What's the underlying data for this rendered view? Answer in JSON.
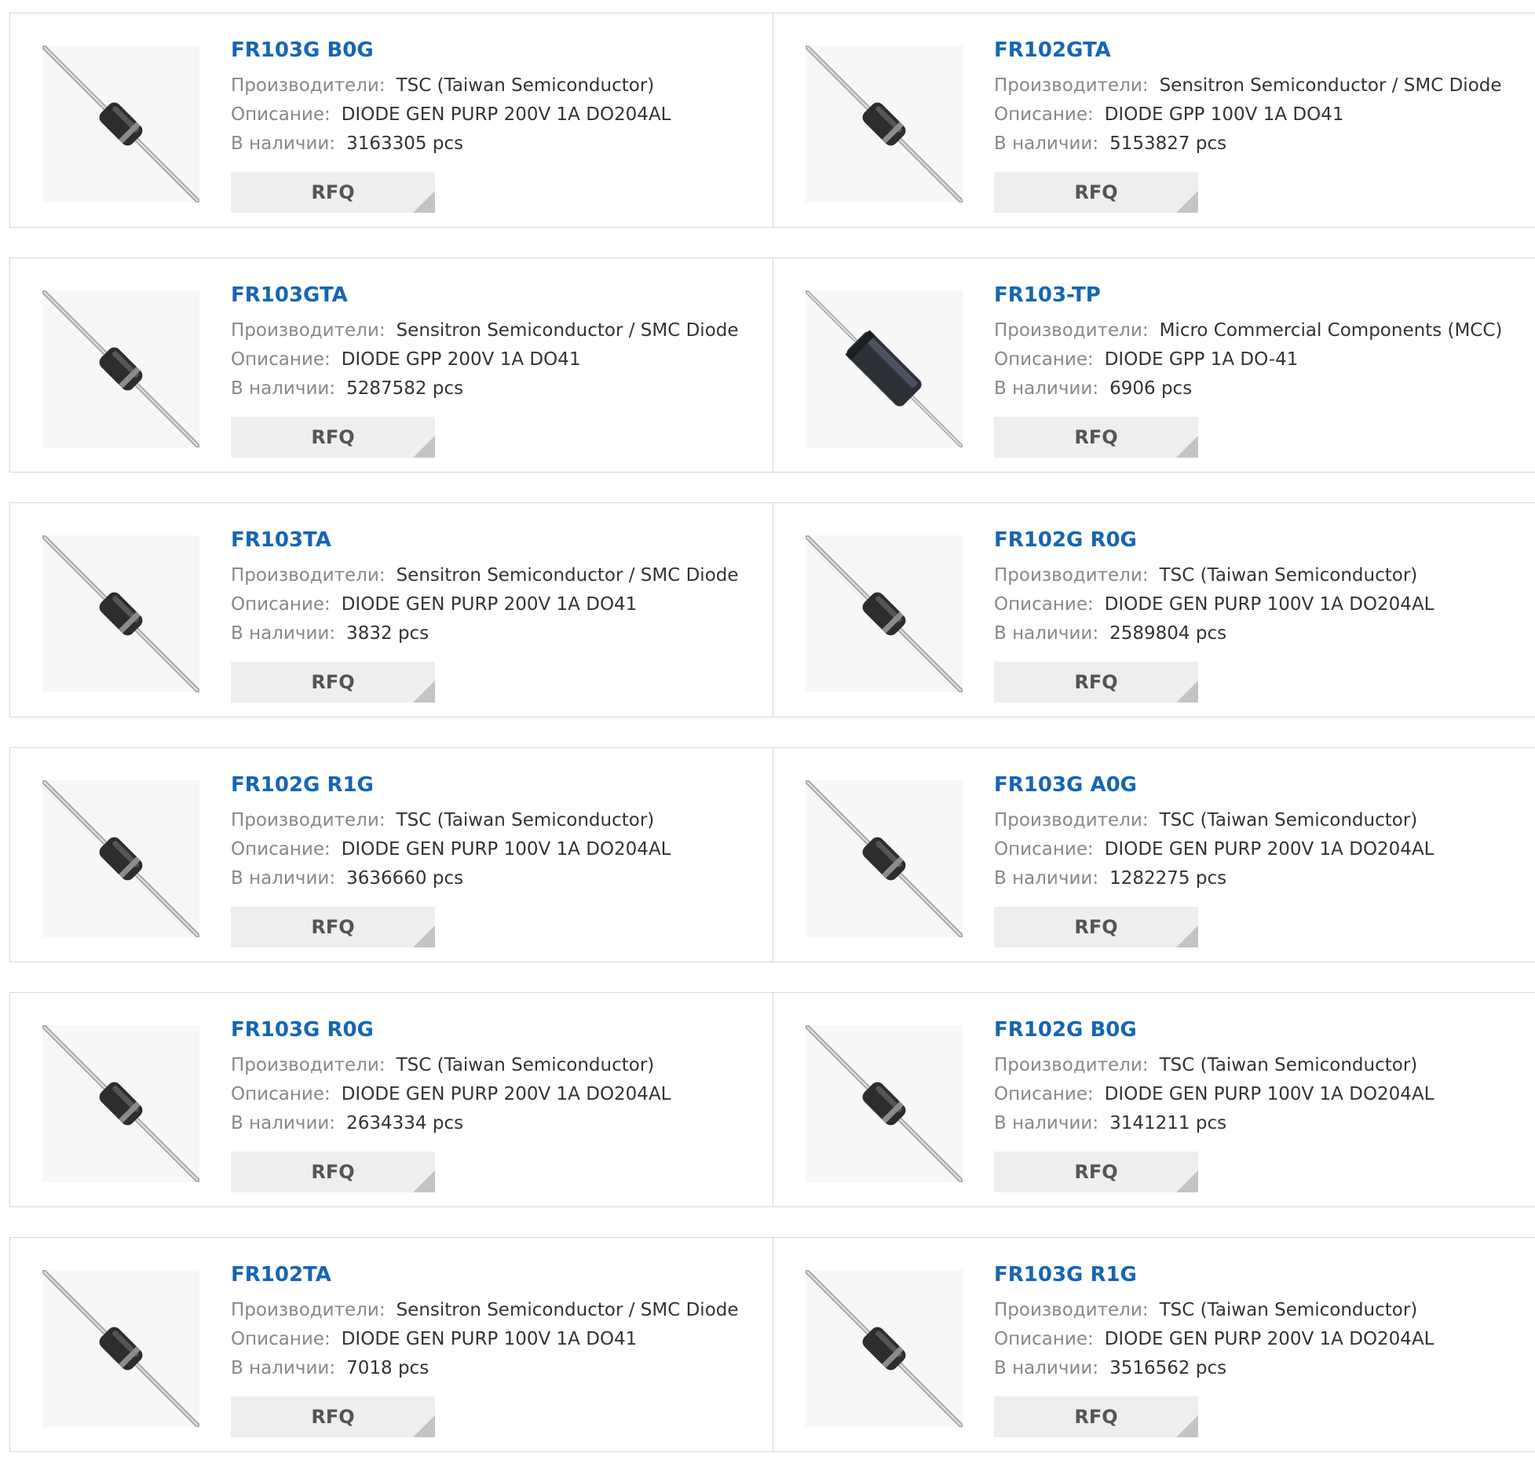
{
  "labels": {
    "manufacturer": "Производители:",
    "description": "Описание:",
    "stock": "В наличии:",
    "rfq": "RFQ"
  },
  "colors": {
    "title": "#1565b5",
    "label": "#888888",
    "border": "#d8d8d8",
    "button": "#eeeeee"
  },
  "products": [
    {
      "part": "FR103G B0G",
      "manufacturer": "TSC (Taiwan Semiconductor)",
      "description": "DIODE GEN PURP 200V 1A DO204AL",
      "stock": "3163305 pcs",
      "image": "diode-axial-icon"
    },
    {
      "part": "FR102GTA",
      "manufacturer": "Sensitron Semiconductor / SMC Diode",
      "description": "DIODE GPP 100V 1A DO41",
      "stock": "5153827 pcs",
      "image": "diode-axial-icon"
    },
    {
      "part": "FR103GTA",
      "manufacturer": "Sensitron Semiconductor / SMC Diode",
      "description": "DIODE GPP 200V 1A DO41",
      "stock": "5287582 pcs",
      "image": "diode-axial-icon"
    },
    {
      "part": "FR103-TP",
      "manufacturer": "Micro Commercial Components (MCC)",
      "description": "DIODE GPP 1A DO-41",
      "stock": "6906 pcs",
      "image": "diode-large-icon"
    },
    {
      "part": "FR103TA",
      "manufacturer": "Sensitron Semiconductor / SMC Diode",
      "description": "DIODE GEN PURP 200V 1A DO41",
      "stock": "3832 pcs",
      "image": "diode-axial-icon"
    },
    {
      "part": "FR102G R0G",
      "manufacturer": "TSC (Taiwan Semiconductor)",
      "description": "DIODE GEN PURP 100V 1A DO204AL",
      "stock": "2589804 pcs",
      "image": "diode-axial-icon"
    },
    {
      "part": "FR102G R1G",
      "manufacturer": "TSC (Taiwan Semiconductor)",
      "description": "DIODE GEN PURP 100V 1A DO204AL",
      "stock": "3636660 pcs",
      "image": "diode-axial-icon"
    },
    {
      "part": "FR103G A0G",
      "manufacturer": "TSC (Taiwan Semiconductor)",
      "description": "DIODE GEN PURP 200V 1A DO204AL",
      "stock": "1282275 pcs",
      "image": "diode-axial-icon"
    },
    {
      "part": "FR103G R0G",
      "manufacturer": "TSC (Taiwan Semiconductor)",
      "description": "DIODE GEN PURP 200V 1A DO204AL",
      "stock": "2634334 pcs",
      "image": "diode-axial-icon"
    },
    {
      "part": "FR102G B0G",
      "manufacturer": "TSC (Taiwan Semiconductor)",
      "description": "DIODE GEN PURP 100V 1A DO204AL",
      "stock": "3141211 pcs",
      "image": "diode-axial-icon"
    },
    {
      "part": "FR102TA",
      "manufacturer": "Sensitron Semiconductor / SMC Diode",
      "description": "DIODE GEN PURP 100V 1A DO41",
      "stock": "7018 pcs",
      "image": "diode-axial-icon"
    },
    {
      "part": "FR103G R1G",
      "manufacturer": "TSC (Taiwan Semiconductor)",
      "description": "DIODE GEN PURP 200V 1A DO204AL",
      "stock": "3516562 pcs",
      "image": "diode-axial-icon"
    }
  ]
}
